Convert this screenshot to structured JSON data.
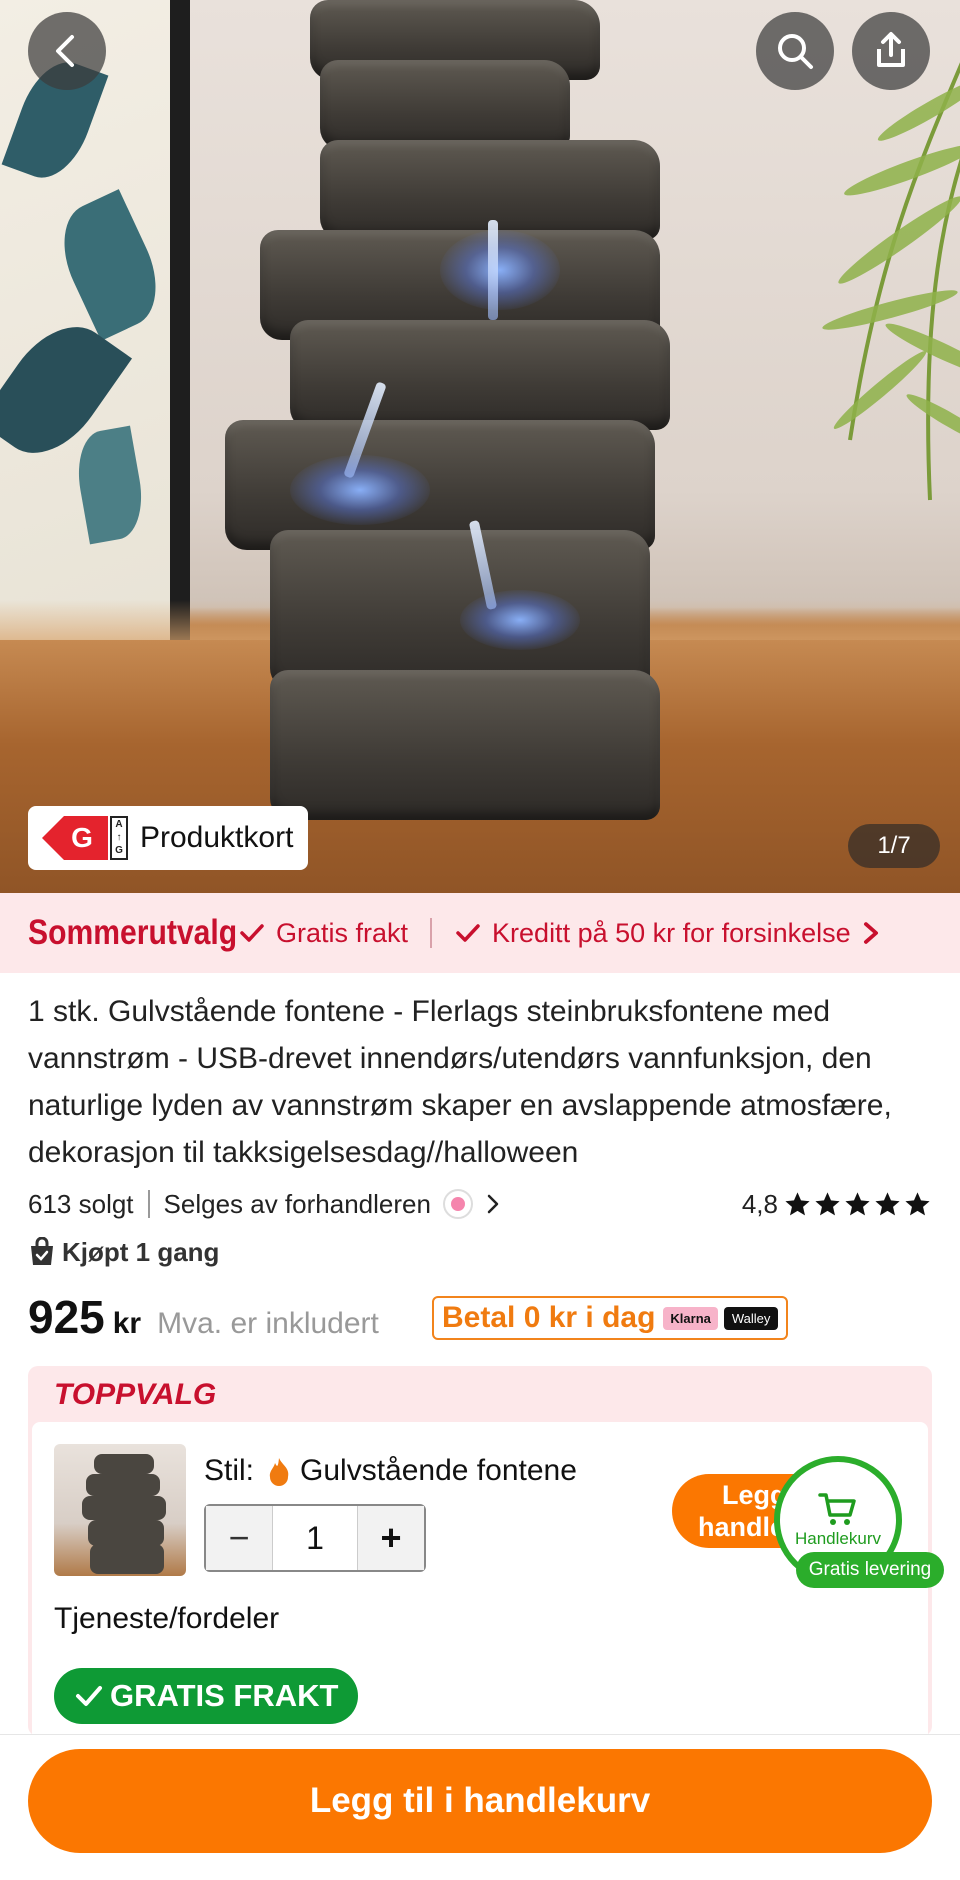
{
  "gallery": {
    "counter": "1/7",
    "produktkort_label": "Produktkort",
    "energy_class": "G",
    "energy_scale": [
      "A",
      "↑",
      "G"
    ]
  },
  "promo": {
    "title": "Sommerutvalg",
    "items": [
      "Gratis frakt",
      "Kreditt på 50 kr for forsinkelse"
    ],
    "accent": "#c8102e",
    "background": "#fde8ea"
  },
  "product": {
    "title": "1 stk. Gulvstående fontene - Flerlags steinbruksfontene med vannstrøm - USB-drevet innendørs/utendørs vannfunksjon, den naturlige lyden av vannstrøm skaper en avslappende atmosfære, dekorasjon til takksigelsesdag//halloween",
    "sold": "613 solgt",
    "seller": "Selges av forhandleren",
    "rating": "4,8",
    "stars": 5,
    "bought": "Kjøpt 1 gang"
  },
  "price": {
    "amount": "925",
    "currency": "kr",
    "vat_note": "Mva. er inkludert",
    "bnpl": "Betal 0 kr i dag",
    "bnpl_providers": [
      "Klarna",
      "Walley"
    ]
  },
  "toppvalg": {
    "label": "TOPPVALG",
    "style_label": "Stil:",
    "style_value": "Gulvstående fontene",
    "quantity": "1",
    "minus": "−",
    "plus": "+",
    "add_button": "Legg til handlekurv",
    "service_label": "Tjeneste/fordeler",
    "free_shipping_badge": "GRATIS FRAKT"
  },
  "cart_bubble": {
    "label": "Handlekurv",
    "free_delivery": "Gratis levering",
    "color": "#2bad2b"
  },
  "bottom": {
    "add_to_cart": "Legg til i handlekurv",
    "color": "#fb7701"
  },
  "icons": [
    "back-icon",
    "search-icon",
    "share-icon",
    "check-icon",
    "chevron-right-icon",
    "star-icon",
    "shopping-bag-icon",
    "flame-icon",
    "cart-icon"
  ]
}
